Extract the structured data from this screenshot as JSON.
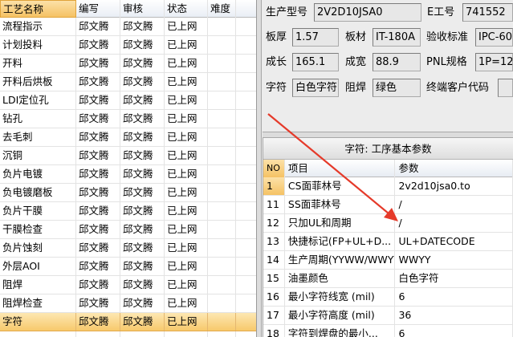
{
  "process_table": {
    "headers": {
      "name": "工艺名称",
      "author": "编写",
      "reviewer": "审核",
      "status": "状态",
      "difficulty": "难度"
    },
    "rows": [
      {
        "name": "流程指示",
        "author": "邱文腾",
        "reviewer": "邱文腾",
        "status": "已上网",
        "difficulty": ""
      },
      {
        "name": "计划投料",
        "author": "邱文腾",
        "reviewer": "邱文腾",
        "status": "已上网",
        "difficulty": ""
      },
      {
        "name": "开料",
        "author": "邱文腾",
        "reviewer": "邱文腾",
        "status": "已上网",
        "difficulty": ""
      },
      {
        "name": "开料后烘板",
        "author": "邱文腾",
        "reviewer": "邱文腾",
        "status": "已上网",
        "difficulty": ""
      },
      {
        "name": "LDI定位孔",
        "author": "邱文腾",
        "reviewer": "邱文腾",
        "status": "已上网",
        "difficulty": ""
      },
      {
        "name": "钻孔",
        "author": "邱文腾",
        "reviewer": "邱文腾",
        "status": "已上网",
        "difficulty": ""
      },
      {
        "name": "去毛刺",
        "author": "邱文腾",
        "reviewer": "邱文腾",
        "status": "已上网",
        "difficulty": ""
      },
      {
        "name": "沉铜",
        "author": "邱文腾",
        "reviewer": "邱文腾",
        "status": "已上网",
        "difficulty": ""
      },
      {
        "name": "负片电镀",
        "author": "邱文腾",
        "reviewer": "邱文腾",
        "status": "已上网",
        "difficulty": ""
      },
      {
        "name": "负电镀磨板",
        "author": "邱文腾",
        "reviewer": "邱文腾",
        "status": "已上网",
        "difficulty": ""
      },
      {
        "name": "负片干膜",
        "author": "邱文腾",
        "reviewer": "邱文腾",
        "status": "已上网",
        "difficulty": ""
      },
      {
        "name": "干膜检查",
        "author": "邱文腾",
        "reviewer": "邱文腾",
        "status": "已上网",
        "difficulty": ""
      },
      {
        "name": "负片蚀刻",
        "author": "邱文腾",
        "reviewer": "邱文腾",
        "status": "已上网",
        "difficulty": ""
      },
      {
        "name": "外层AOI",
        "author": "邱文腾",
        "reviewer": "邱文腾",
        "status": "已上网",
        "difficulty": ""
      },
      {
        "name": "阻焊",
        "author": "邱文腾",
        "reviewer": "邱文腾",
        "status": "已上网",
        "difficulty": ""
      },
      {
        "name": "阻焊检查",
        "author": "邱文腾",
        "reviewer": "邱文腾",
        "status": "已上网",
        "difficulty": ""
      },
      {
        "name": "字符",
        "author": "邱文腾",
        "reviewer": "邱文腾",
        "status": "已上网",
        "difficulty": ""
      },
      {
        "name": "",
        "author": "",
        "reviewer": "",
        "status": "",
        "difficulty": ""
      }
    ]
  },
  "form": {
    "model_label": "生产型号",
    "model_value": "2V2D10JSA0",
    "eno_label": "E工号",
    "eno_value": "741552",
    "thickness_label": "板厚",
    "thickness_value": "1.57",
    "material_label": "板材",
    "material_value": "IT-180A",
    "standard_label": "验收标准",
    "standard_value": "IPC-60",
    "length_label": "成长",
    "length_value": "165.1",
    "width_label": "成宽",
    "width_value": "88.9",
    "pnl_label": "PNL规格",
    "pnl_value": "1P=12",
    "char_label": "字符",
    "char_value": "白色字符",
    "solder_label": "阻焊",
    "solder_value": "绿色",
    "customer_label": "终端客户代码",
    "customer_value": ""
  },
  "params": {
    "title": "字符: 工序基本参数",
    "headers": {
      "no": "NO",
      "item": "项目",
      "value": "参数"
    },
    "rows": [
      {
        "no": "1",
        "item": "CS面菲林号",
        "value": "2v2d10jsa0.to"
      },
      {
        "no": "11",
        "item": "SS面菲林号",
        "value": "/"
      },
      {
        "no": "12",
        "item": "只加UL和周期",
        "value": "/"
      },
      {
        "no": "13",
        "item": "快捷标记(FP+UL+D...",
        "value": "UL+DATECODE"
      },
      {
        "no": "14",
        "item": "生产周期(YYWW/WWYY)",
        "value": "WWYY"
      },
      {
        "no": "15",
        "item": "油墨颜色",
        "value": "白色字符"
      },
      {
        "no": "16",
        "item": "最小字符线宽 (mil)",
        "value": "6"
      },
      {
        "no": "17",
        "item": "最小字符高度 (mil)",
        "value": "36"
      },
      {
        "no": "18",
        "item": "字符到焊盘的最小...",
        "value": "6"
      }
    ]
  },
  "colors": {
    "selected_row": "#f7c96c",
    "annotation_arrow": "#e53a2a"
  }
}
